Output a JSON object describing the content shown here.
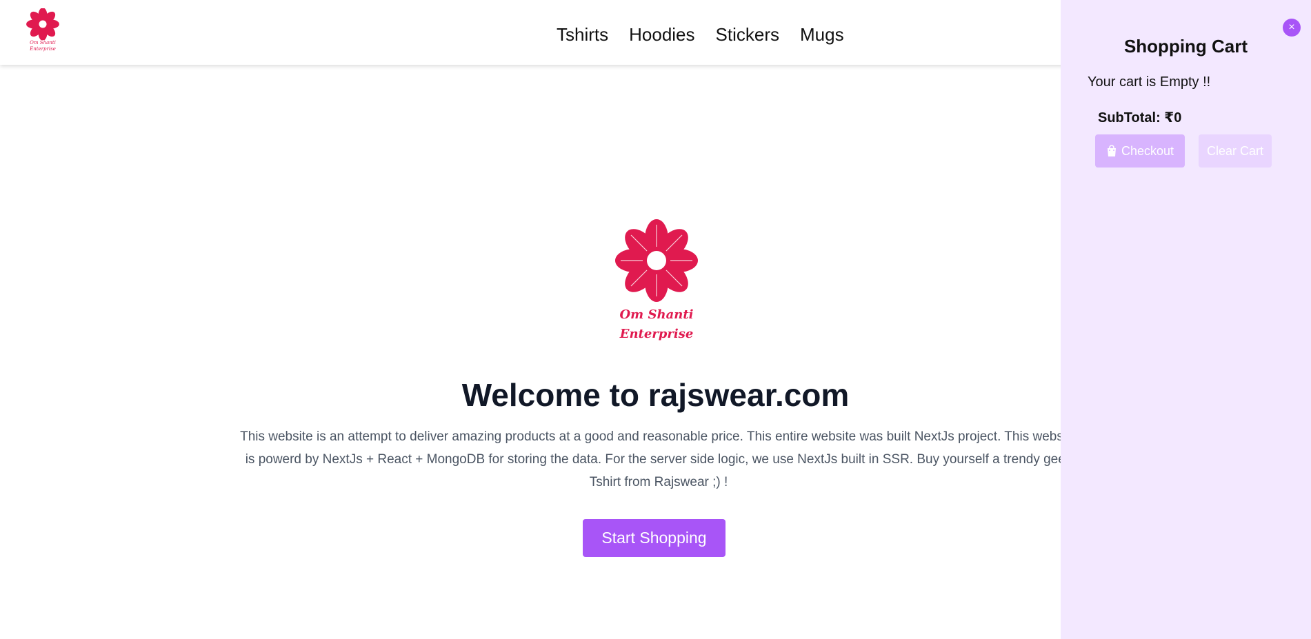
{
  "header": {
    "logo_text_line1": "Om Shanti",
    "logo_text_line2": "Enterprise",
    "nav": [
      "Tshirts",
      "Hoodies",
      "Stickers",
      "Mugs"
    ]
  },
  "hero": {
    "logo_text_line1": "Om Shanti",
    "logo_text_line2": "Enterprise",
    "title": "Welcome to rajswear.com",
    "description": "This website is an attempt to deliver amazing products at a good and reasonable price. This entire website was built NextJs project. This website is powerd by NextJs + React + MongoDB for storing the data. For the server side logic, we use NextJs built in SSR. Buy yourself a trendy geek Tshirt from Rajswear ;) !",
    "cta_label": "Start Shopping"
  },
  "cart": {
    "title": "Shopping Cart",
    "close_label": "×",
    "empty_message": "Your cart is Empty !!",
    "subtotal": "SubTotal: ₹0",
    "checkout_label": "Checkout",
    "clear_label": "Clear Cart",
    "checkout_icon": "shopping-bag-icon"
  },
  "colors": {
    "accent": "#a855f7",
    "logo": "#e01a4f",
    "cart_bg": "#f3e8ff"
  }
}
